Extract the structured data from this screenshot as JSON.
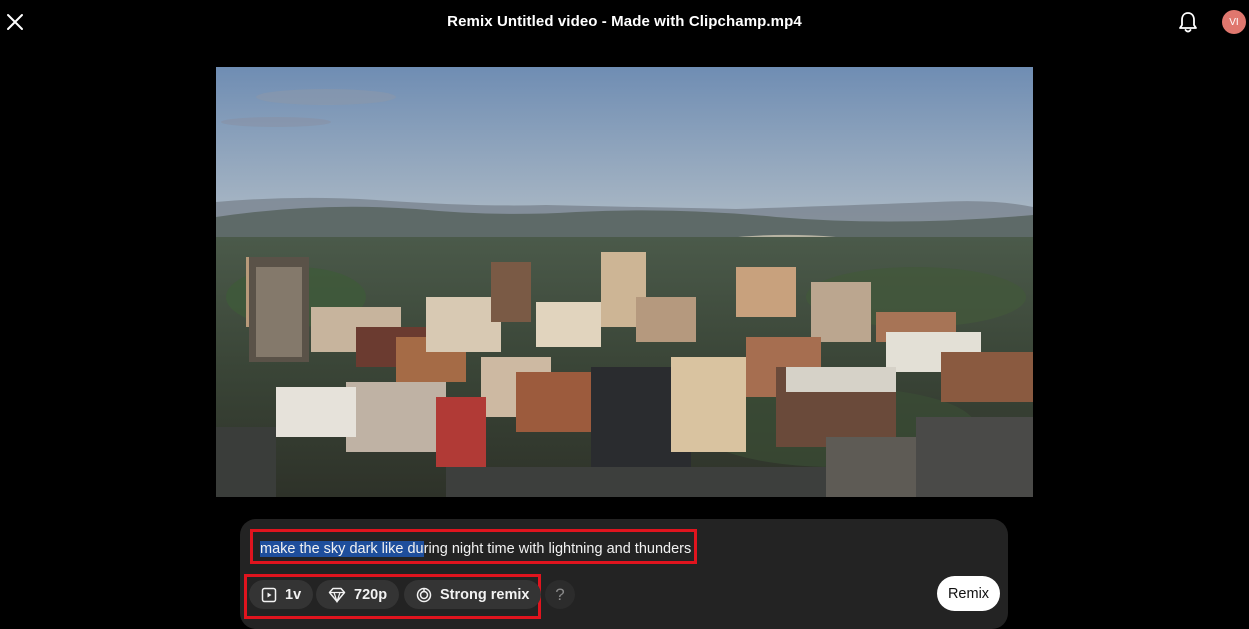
{
  "header": {
    "title": "Remix Untitled video - Made with Clipchamp.mp4",
    "close_icon": "close-icon",
    "bell_icon": "bell-icon",
    "avatar_initials": "VI",
    "avatar_color": "#e0776e"
  },
  "preview": {
    "scene": "aerial city skyline at dusk"
  },
  "composer": {
    "prompt_selected": "make the sky dark like du",
    "prompt_rest": "ring night time with lightning and thunders",
    "options": [
      {
        "icon": "video-count-icon",
        "label": "1v"
      },
      {
        "icon": "diamond-icon",
        "label": "720p"
      },
      {
        "icon": "remix-strength-icon",
        "label": "Strong remix"
      }
    ],
    "help_label": "?",
    "remix_label": "Remix"
  },
  "colors": {
    "highlight": "#e0141e",
    "selection": "#1e4e9c",
    "panel": "#232323"
  }
}
